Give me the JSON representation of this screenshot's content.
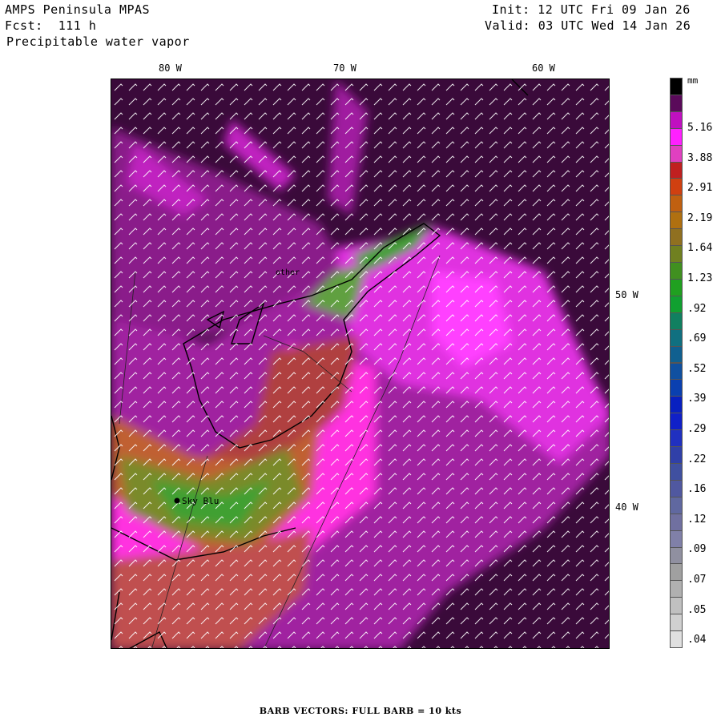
{
  "header": {
    "title": "AMPS Peninsula MPAS",
    "fcst": "Fcst:  111 h",
    "field": "Precipitable water vapor",
    "init": "Init: 12 UTC Fri 09 Jan 26",
    "valid": "Valid: 03 UTC Wed 14 Jan 26"
  },
  "map": {
    "lon_labels": [
      "80 W",
      "70 W",
      "60 W",
      "50 W",
      "40 W"
    ],
    "stations": [
      {
        "name": "Sky Blu"
      }
    ],
    "other_text": "other"
  },
  "legend": {
    "unit": "mm",
    "values": [
      "5.16",
      "3.88",
      "2.91",
      "2.19",
      "1.64",
      "1.23",
      ".92",
      ".69",
      ".52",
      ".39",
      ".29",
      ".22",
      ".16",
      ".12",
      ".09",
      ".07",
      ".05",
      ".04"
    ],
    "colors": [
      "#000000",
      "#5a0a5a",
      "#c010c0",
      "#ff20ff",
      "#e040c0",
      "#c02020",
      "#d04010",
      "#c06010",
      "#b07010",
      "#907020",
      "#708020",
      "#409020",
      "#20a020",
      "#10a030",
      "#108060",
      "#107080",
      "#106090",
      "#1050a0",
      "#0a40b0",
      "#0820c0",
      "#1020c8",
      "#2030c0",
      "#3040a8",
      "#4050a0",
      "#5058a0",
      "#6068a0",
      "#7070a0",
      "#8080a8",
      "#9090a0",
      "#a0a0a0",
      "#b0b0b0",
      "#c0c0c0",
      "#d0d0d0",
      "#e0e0e0"
    ]
  },
  "footer": "BARB VECTORS:  FULL BARB = 10 kts"
}
